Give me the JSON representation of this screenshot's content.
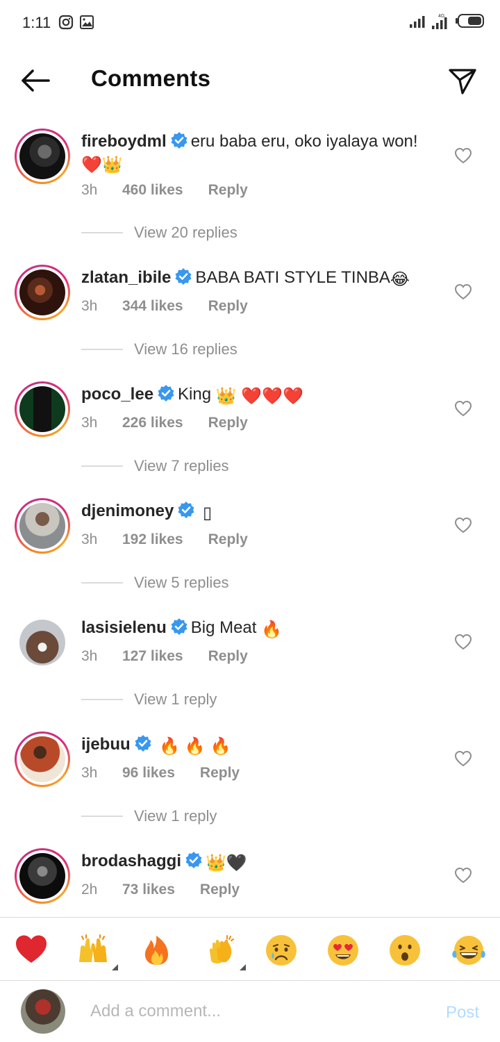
{
  "status_bar": {
    "time": "1:11",
    "icons": [
      "instagram-notification-icon",
      "gallery-notification-icon",
      "signal-icon",
      "signal-icon",
      "battery-icon"
    ]
  },
  "header": {
    "title": "Comments",
    "back_icon": "back-arrow-icon",
    "share_icon": "send-icon"
  },
  "comments": [
    {
      "username": "fireboydml",
      "text": "eru baba eru, oko iyalaya won!",
      "emojis": [
        "❤️",
        "👑"
      ],
      "time": "3h",
      "likes": "460 likes",
      "reply": "Reply",
      "view_replies": "View 20 replies"
    },
    {
      "username": "zlatan_ibile",
      "text": "BABA BATI STYLE TINBA",
      "emojis": [
        "😂"
      ],
      "time": "3h",
      "likes": "344 likes",
      "reply": "Reply",
      "view_replies": "View 16 replies"
    },
    {
      "username": "poco_lee",
      "text": "King",
      "emojis": [
        "👑",
        "❤️",
        "❤️",
        "❤️"
      ],
      "time": "3h",
      "likes": "226 likes",
      "reply": "Reply",
      "view_replies": "View 7 replies"
    },
    {
      "username": "djenimoney",
      "text": "",
      "emojis": [
        "▯"
      ],
      "time": "3h",
      "likes": "192 likes",
      "reply": "Reply",
      "view_replies": "View 5 replies"
    },
    {
      "username": "lasisielenu",
      "text": "Big Meat",
      "emojis": [
        "🔥"
      ],
      "time": "3h",
      "likes": "127 likes",
      "reply": "Reply",
      "view_replies": "View 1 reply"
    },
    {
      "username": "ijebuu",
      "text": "",
      "emojis": [
        "🔥",
        "🔥",
        "🔥"
      ],
      "time": "3h",
      "likes": "96 likes",
      "reply": "Reply",
      "view_replies": "View 1 reply"
    },
    {
      "username": "brodashaggi",
      "text": "",
      "emojis": [
        "👑",
        "🖤"
      ],
      "time": "2h",
      "likes": "73 likes",
      "reply": "Reply",
      "view_replies": ""
    }
  ],
  "emoji_bar": [
    "❤️",
    "🙌",
    "🔥",
    "👏",
    "😢",
    "😍",
    "😮",
    "😂"
  ],
  "composer": {
    "placeholder": "Add a comment...",
    "post_label": "Post"
  },
  "colors": {
    "verified": "#3897f0",
    "meta_gray": "#8e8e8e",
    "post_disabled": "#b3dbff",
    "divider": "#dbdbdb"
  }
}
